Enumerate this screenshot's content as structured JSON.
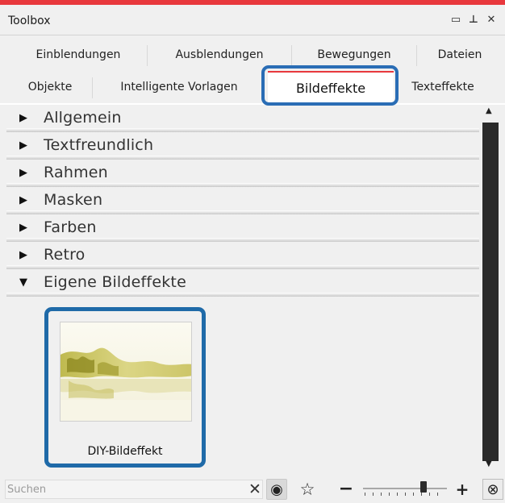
{
  "window": {
    "title": "Toolbox",
    "controls": [
      {
        "icon": "maximize-icon",
        "glyph": "▭"
      },
      {
        "icon": "pin-icon",
        "glyph": "⊥"
      },
      {
        "icon": "close-icon",
        "glyph": "✕"
      }
    ]
  },
  "tabs": {
    "row1": [
      "Einblendungen",
      "Ausblendungen",
      "Bewegungen",
      "Dateien"
    ],
    "row2": [
      "Objekte",
      "Intelligente Vorlagen",
      "Bildeffekte",
      "Texteffekte"
    ],
    "active": "Bildeffekte"
  },
  "categories": [
    {
      "label": "Allgemein",
      "expanded": false,
      "arrow": "▶"
    },
    {
      "label": "Textfreundlich",
      "expanded": false,
      "arrow": "▶"
    },
    {
      "label": "Rahmen",
      "expanded": false,
      "arrow": "▶"
    },
    {
      "label": "Masken",
      "expanded": false,
      "arrow": "▶"
    },
    {
      "label": "Farben",
      "expanded": false,
      "arrow": "▶"
    },
    {
      "label": "Retro",
      "expanded": false,
      "arrow": "▶"
    },
    {
      "label": "Eigene Bildeffekte",
      "expanded": true,
      "arrow": "▼"
    }
  ],
  "effects": [
    {
      "caption": "DIY-Bildeffekt",
      "highlighted": true
    }
  ],
  "scrollbar": {
    "up_glyph": "▲",
    "down_glyph": "▼"
  },
  "bottombar": {
    "search_placeholder": "Suchen",
    "search_value": "",
    "clear_glyph": "✕",
    "eye_glyph": "◉",
    "star_glyph": "☆",
    "zoom_out_glyph": "−",
    "zoom_in_glyph": "+",
    "fit_glyph": "⊗",
    "zoom_level_fraction": 0.72
  },
  "colors": {
    "accent_red": "#e8383d",
    "highlight_blue": "#1f6aa8"
  }
}
